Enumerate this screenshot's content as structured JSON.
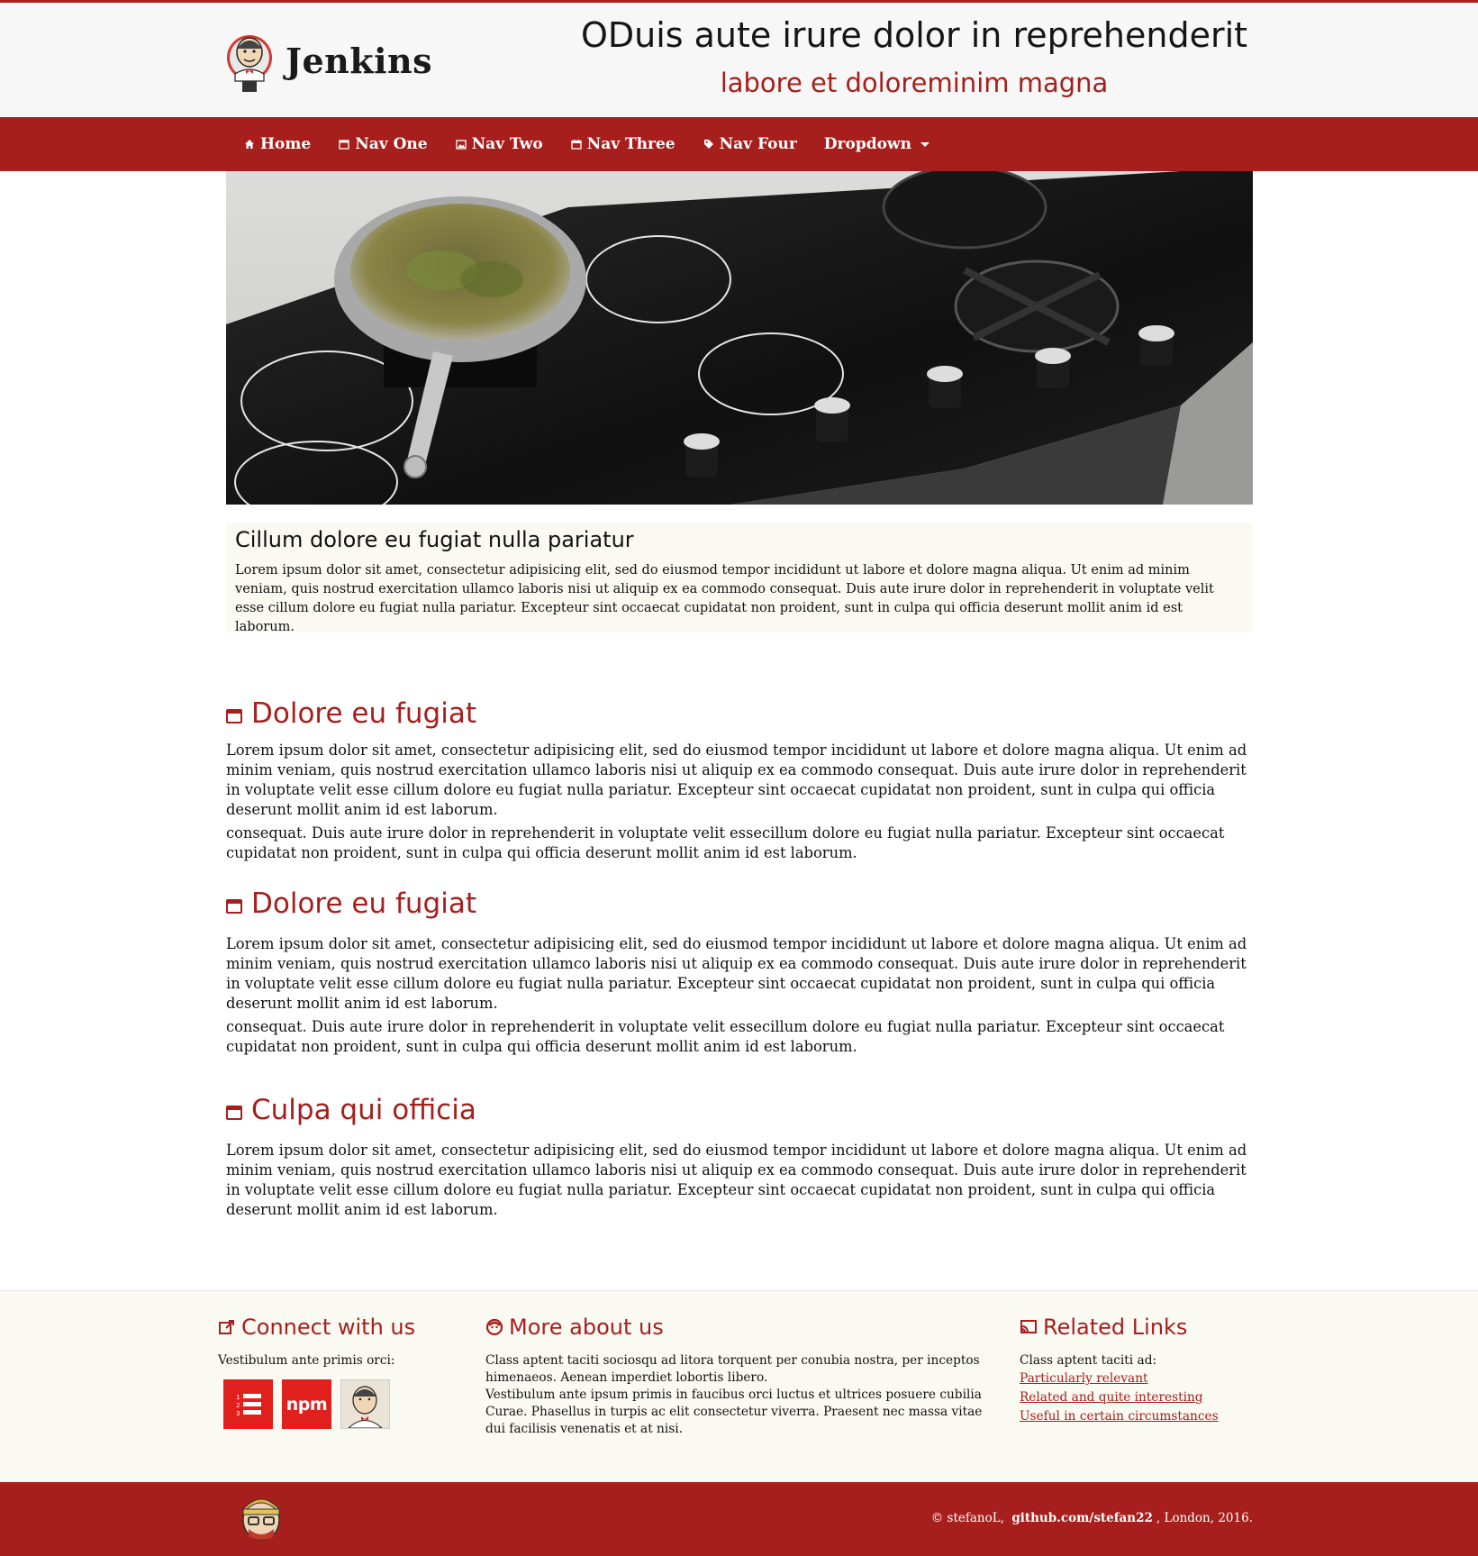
{
  "brand": {
    "logo_text": "Jenkins",
    "accent_color": "#a61f1c"
  },
  "header": {
    "title": "ODuis aute irure dolor in reprehenderit",
    "subtitle": "labore et doloreminim magna"
  },
  "nav": {
    "items": [
      {
        "label": "Home",
        "icon": "home-icon"
      },
      {
        "label": "Nav One",
        "icon": "window-icon"
      },
      {
        "label": "Nav Two",
        "icon": "picture-icon"
      },
      {
        "label": "Nav Three",
        "icon": "calendar-icon"
      },
      {
        "label": "Nav Four",
        "icon": "tag-icon"
      },
      {
        "label": "Dropdown",
        "icon": "caret-down-icon"
      }
    ]
  },
  "intro": {
    "title": "Cillum dolore eu fugiat nulla pariatur",
    "text": "Lorem ipsum dolor sit amet, consectetur adipisicing elit, sed do eiusmod tempor incididunt ut labore et dolore magna aliqua. Ut enim ad minim veniam, quis nostrud exercitation ullamco laboris nisi ut aliquip ex ea commodo consequat. Duis aute irure dolor in reprehenderit in voluptate velit esse cillum dolore eu fugiat nulla pariatur. Excepteur sint occaecat cupidatat non proident, sunt in culpa qui officia deserunt mollit anim id est laborum."
  },
  "sections": [
    {
      "title": "Dolore eu fugiat",
      "p1": "Lorem ipsum dolor sit amet, consectetur adipisicing elit, sed do eiusmod tempor incididunt ut labore et dolore magna aliqua. Ut enim ad minim veniam, quis nostrud exercitation ullamco laboris nisi ut aliquip ex ea commodo consequat. Duis aute irure dolor in reprehenderit in voluptate velit esse cillum dolore eu fugiat nulla pariatur. Excepteur sint occaecat cupidatat non proident, sunt in culpa qui officia deserunt mollit anim id est laborum.",
      "p2": "consequat. Duis aute irure dolor in reprehenderit in voluptate velit essecillum dolore eu fugiat nulla pariatur. Excepteur sint occaecat cupidatat non proident, sunt in culpa qui officia deserunt mollit anim id est laborum."
    },
    {
      "title": "Dolore eu fugiat",
      "p1": "Lorem ipsum dolor sit amet, consectetur adipisicing elit, sed do eiusmod tempor incididunt ut labore et dolore magna aliqua. Ut enim ad minim veniam, quis nostrud exercitation ullamco laboris nisi ut aliquip ex ea commodo consequat. Duis aute irure dolor in reprehenderit in voluptate velit esse cillum dolore eu fugiat nulla pariatur. Excepteur sint occaecat cupidatat non proident, sunt in culpa qui officia deserunt mollit anim id est laborum.",
      "p2": "consequat. Duis aute irure dolor in reprehenderit in voluptate velit essecillum dolore eu fugiat nulla pariatur. Excepteur sint occaecat cupidatat non proident, sunt in culpa qui officia deserunt mollit anim id est laborum."
    },
    {
      "title": "Culpa qui officia",
      "p1": "Lorem ipsum dolor sit amet, consectetur adipisicing elit, sed do eiusmod tempor incididunt ut labore et dolore magna aliqua. Ut enim ad minim veniam, quis nostrud exercitation ullamco laboris nisi ut aliquip ex ea commodo consequat. Duis aute irure dolor in reprehenderit in voluptate velit esse cillum dolore eu fugiat nulla pariatur. Excepteur sint occaecat cupidatat non proident, sunt in culpa qui officia deserunt mollit anim id est laborum."
    }
  ],
  "footer": {
    "connect": {
      "title": "Connect with us",
      "lead": "Vestibulum ante primis orci:",
      "socials": [
        "list-icon",
        "npm-icon",
        "jenkins-icon"
      ],
      "npm_label": "npm"
    },
    "about": {
      "title": "More about us",
      "p1": "Class aptent taciti sociosqu ad litora torquent per conubia nostra, per inceptos himenaeos. Aenean imperdiet lobortis libero.",
      "p2": "Vestibulum ante ipsum primis in faucibus orci luctus et ultrices posuere cubilia Curae. Phasellus in turpis ac elit consectetur viverra. Praesent nec massa vitae dui facilisis venenatis et at nisi."
    },
    "related": {
      "title": "Related Links",
      "lead": "Class aptent taciti ad:",
      "links": [
        "Particularly relevant",
        "Related and quite interesting",
        "Useful in certain circumstances"
      ]
    }
  },
  "bottom": {
    "copyright": "© stefanoL,",
    "github": "github.com/stefan22",
    "location": ", London, 2016."
  }
}
